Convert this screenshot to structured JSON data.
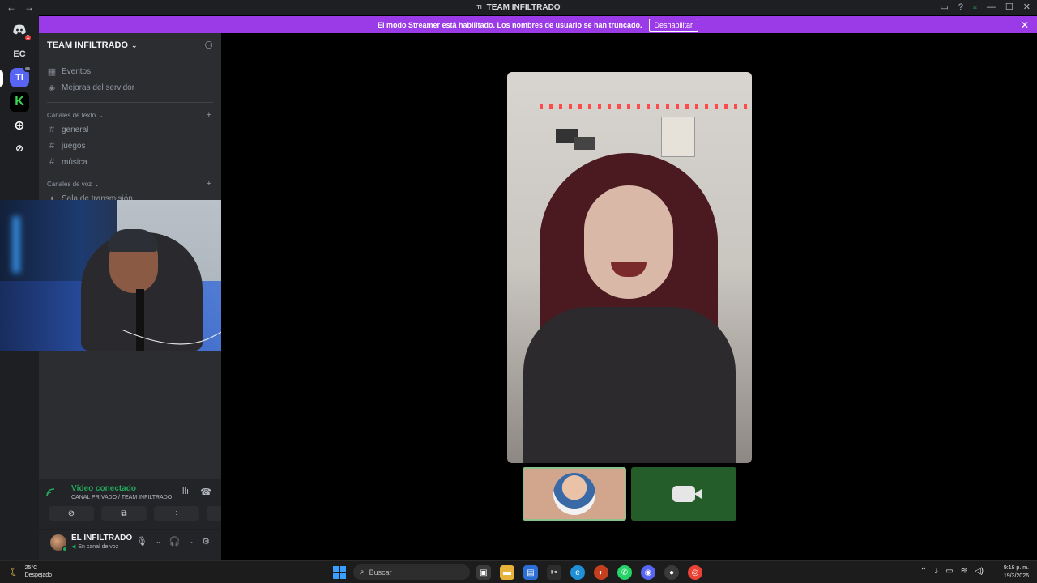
{
  "window": {
    "title": "TEAM INFILTRADO",
    "server_abbr": "TI"
  },
  "banner": {
    "text": "El modo Streamer está habilitado. Los nombres de usuario se han truncado.",
    "button": "Deshabilitar"
  },
  "rail": {
    "discord_badge": "1",
    "servers": [
      "EC",
      "TI",
      "K"
    ]
  },
  "sidebar": {
    "server_name": "TEAM INFILTRADO",
    "top_items": [
      "Eventos",
      "Mejoras del servidor"
    ],
    "text_category": "Canales de texto",
    "text_channels": [
      "general",
      "juegos",
      "música"
    ],
    "voice_category": "Canales de voz",
    "voice_channels": [
      "Sala de transmisión"
    ]
  },
  "voice": {
    "status": "Vídeo conectado",
    "channel": "CANAL PRIVADO / TEAM INFILTRADO"
  },
  "user": {
    "name": "EL INFILTRADO",
    "status": "En canal de voz"
  },
  "taskbar": {
    "temp": "25°C",
    "weather": "Despejado",
    "search_placeholder": "Buscar",
    "time": "9:18 p. m.",
    "date": "19/3/2026"
  },
  "colors": {
    "banner": "#9b3be8",
    "connected": "#23a55a",
    "blurple": "#5865f2"
  }
}
